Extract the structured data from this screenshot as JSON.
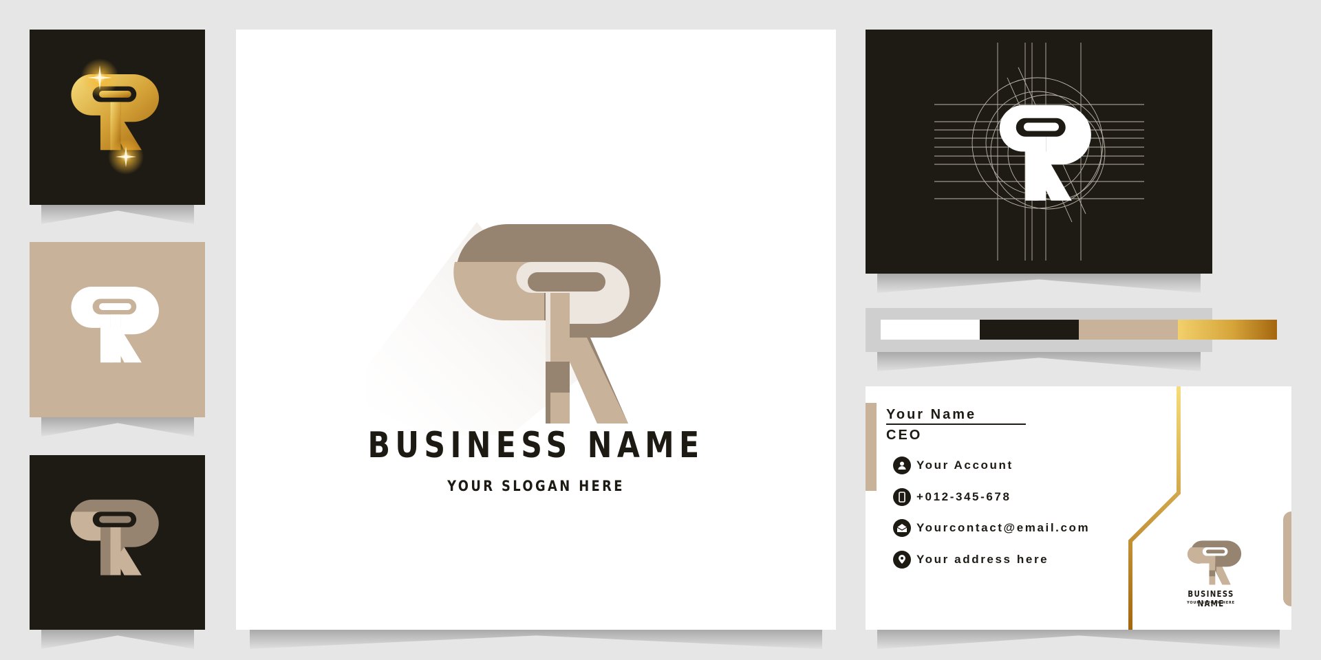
{
  "brand": {
    "monogram": "TR",
    "business_name": "BUSINESS NAME",
    "slogan": "YOUR SLOGAN HERE"
  },
  "colors": {
    "background": "#e6e6e6",
    "dark": "#1e1b14",
    "beige": "#c8b29a",
    "taupe": "#968370",
    "white": "#ffffff",
    "gold_light": "#f2d06b",
    "gold_dark": "#a4660f"
  },
  "tiles": [
    {
      "name": "gold-on-dark",
      "style": "gold"
    },
    {
      "name": "white-on-beige",
      "style": "white"
    },
    {
      "name": "beige-on-dark",
      "style": "beige"
    }
  ],
  "palette": {
    "swatches": [
      {
        "name": "white",
        "color": "#ffffff"
      },
      {
        "name": "black",
        "color": "#1e1b14"
      },
      {
        "name": "beige",
        "color": "#c8b29a"
      },
      {
        "name": "gold",
        "color": "gold-gradient"
      }
    ]
  },
  "business_card": {
    "name": "Your Name",
    "title": "CEO",
    "contacts": [
      {
        "icon": "user-icon",
        "label": "Your Account"
      },
      {
        "icon": "phone-icon",
        "label": "+012-345-678"
      },
      {
        "icon": "mail-icon",
        "label": "Yourcontact@email.com"
      },
      {
        "icon": "location-pin-icon",
        "label": "Your address here"
      }
    ],
    "logo_business_name": "BUSINESS NAME",
    "logo_slogan": "YOUR SLOGAN HERE"
  }
}
